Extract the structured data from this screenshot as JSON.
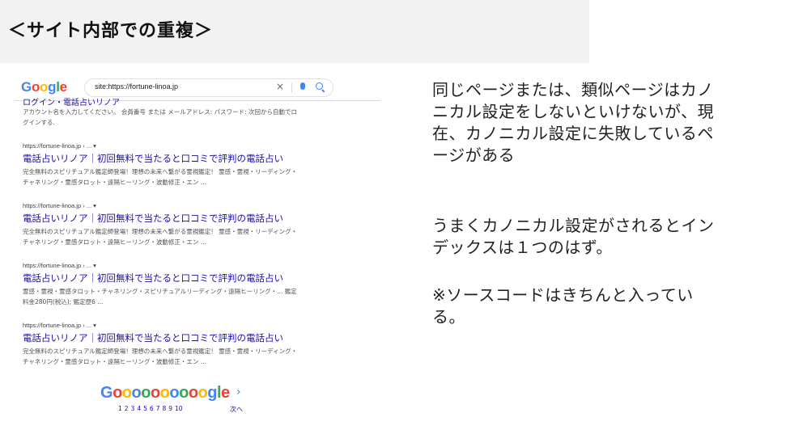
{
  "heading": "＜サイト内部での重複＞",
  "serp": {
    "logo": [
      "G",
      "o",
      "o",
      "g",
      "l",
      "e"
    ],
    "search_query": "site:https://fortune-linoa.jp",
    "top_cut_title": "ログイン・電話占いリノア",
    "top_cut_snippet": "アカウント名を入力してください。 会員番号 または メールアドレス: パスワード: 次回から自動でログインする.",
    "results": [
      {
        "url": "https://fortune-linoa.jp › ... ▾",
        "title": "電話占いリノア｜初回無料で当たると口コミで評判の電話占い",
        "snippet": "完全無料のスピリチュアル鑑定師登場！理想の未来へ繋がる霊視鑑定！ 霊感・霊視・リーディング・チャネリング・霊感タロット・遠隔ヒーリング・波動修正・エン ..."
      },
      {
        "url": "https://fortune-linoa.jp › ... ▾",
        "title": "電話占いリノア｜初回無料で当たると口コミで評判の電話占い",
        "snippet": "完全無料のスピリチュアル鑑定師登場！理想の未来へ繋がる霊視鑑定！ 霊感・霊視・リーディング・チャネリング・霊感タロット・遠隔ヒーリング・波動修正・エン ..."
      },
      {
        "url": "https://fortune-linoa.jp › ... ▾",
        "title": "電話占いリノア｜初回無料で当たると口コミで評判の電話占い",
        "snippet": "霊感・霊視・霊感タロット・チャネリング・スピリチュアルリーディング・遠隔ヒーリング・... 鑑定料金280円(税込); 鑑定歴6 ..."
      },
      {
        "url": "https://fortune-linoa.jp › ... ▾",
        "title": "電話占いリノア｜初回無料で当たると口コミで評判の電話占い",
        "snippet": "完全無料のスピリチュアル鑑定師登場！理想の未来へ繋がる霊視鑑定！ 霊感・霊視・リーディング・チャネリング・霊感タロット・遠隔ヒーリング・波動修正・エン ..."
      }
    ],
    "pager": {
      "pages": [
        "1",
        "2",
        "3",
        "4",
        "5",
        "6",
        "7",
        "8",
        "9",
        "10"
      ],
      "next_label": "次へ"
    }
  },
  "note": {
    "paragraph1": "同じページまたは、類似ページはカノニカル設定をしないといけないが、現在、カノニカル設定に失敗しているページがある",
    "paragraph2": "うまくカノニカル設定がされるとインデックスは１つのはず。",
    "paragraph3": "※ソースコードはきちんと入っている。"
  },
  "colors": {
    "link": "#1a0dab",
    "google_blue": "#4285f4",
    "google_red": "#ea4335",
    "google_yellow": "#fbbc05",
    "google_green": "#34a853"
  }
}
